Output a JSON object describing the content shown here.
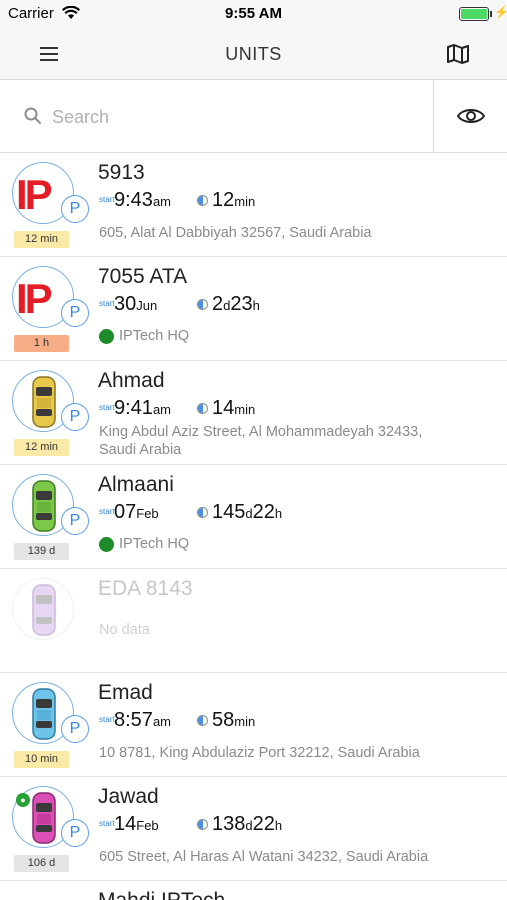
{
  "status_bar": {
    "carrier": "Carrier",
    "time": "9:55 AM"
  },
  "nav": {
    "title": "UNITS",
    "menu_icon": "hamburger-menu-icon",
    "map_icon": "map-icon"
  },
  "search": {
    "placeholder": "Search",
    "value": "",
    "filter_icon": "eye-icon"
  },
  "colors": {
    "accent": "#3d86de",
    "badge_yellow": "#fbe9a7",
    "badge_orange": "#f7ad86",
    "badge_gray": "#e4e4e4",
    "geofence_green": "#1e8a28"
  },
  "units": [
    {
      "name": "5913",
      "start_label": "start",
      "start_main": "9:43",
      "start_unit": "am",
      "dur_a": "12",
      "dur_a_unit": "min",
      "dur_b": "",
      "dur_b_unit": "",
      "address": "605, Alat Al Dabbiyah 32567, Saudi Arabia",
      "geofence": "",
      "badge": "12 min",
      "badge_color": "yellow",
      "avatar": "ip-logo"
    },
    {
      "name": "7055 ATA",
      "start_label": "start",
      "start_main": "30",
      "start_unit": "Jun",
      "dur_a": "2",
      "dur_a_unit": "d",
      "dur_b": "23",
      "dur_b_unit": "h",
      "address": "",
      "geofence": "IPTech HQ",
      "badge": "1 h",
      "badge_color": "orange",
      "avatar": "ip-logo"
    },
    {
      "name": "Ahmad",
      "start_label": "start",
      "start_main": "9:41",
      "start_unit": "am",
      "dur_a": "14",
      "dur_a_unit": "min",
      "dur_b": "",
      "dur_b_unit": "",
      "address": "King Abdul Aziz Street, Al Mohammadeyah 32433, Saudi Arabia",
      "geofence": "",
      "badge": "12 min",
      "badge_color": "yellow",
      "avatar": "car-yellow"
    },
    {
      "name": "Almaani",
      "start_label": "start",
      "start_main": "07",
      "start_unit": "Feb",
      "dur_a": "145",
      "dur_a_unit": "d",
      "dur_b": "22",
      "dur_b_unit": "h",
      "address": "",
      "geofence": "IPTech HQ",
      "badge": "139 d",
      "badge_color": "gray",
      "avatar": "car-green"
    },
    {
      "name": "EDA 8143",
      "no_data": "No data",
      "avatar": "car-purple"
    },
    {
      "name": "Emad",
      "start_label": "start",
      "start_main": "8:57",
      "start_unit": "am",
      "dur_a": "58",
      "dur_a_unit": "min",
      "dur_b": "",
      "dur_b_unit": "",
      "address": "10 8781, King Abdulaziz Port 32212, Saudi Arabia",
      "geofence": "",
      "badge": "10 min",
      "badge_color": "yellow",
      "avatar": "car-blue"
    },
    {
      "name": "Jawad",
      "start_label": "start",
      "start_main": "14",
      "start_unit": "Feb",
      "dur_a": "138",
      "dur_a_unit": "d",
      "dur_b": "22",
      "dur_b_unit": "h",
      "address": "605 Street, Al Haras Al Watani 34232, Saudi Arabia",
      "geofence": "",
      "badge": "106 d",
      "badge_color": "gray",
      "avatar": "car-pink"
    },
    {
      "name": "Mahdi IPTech"
    }
  ]
}
